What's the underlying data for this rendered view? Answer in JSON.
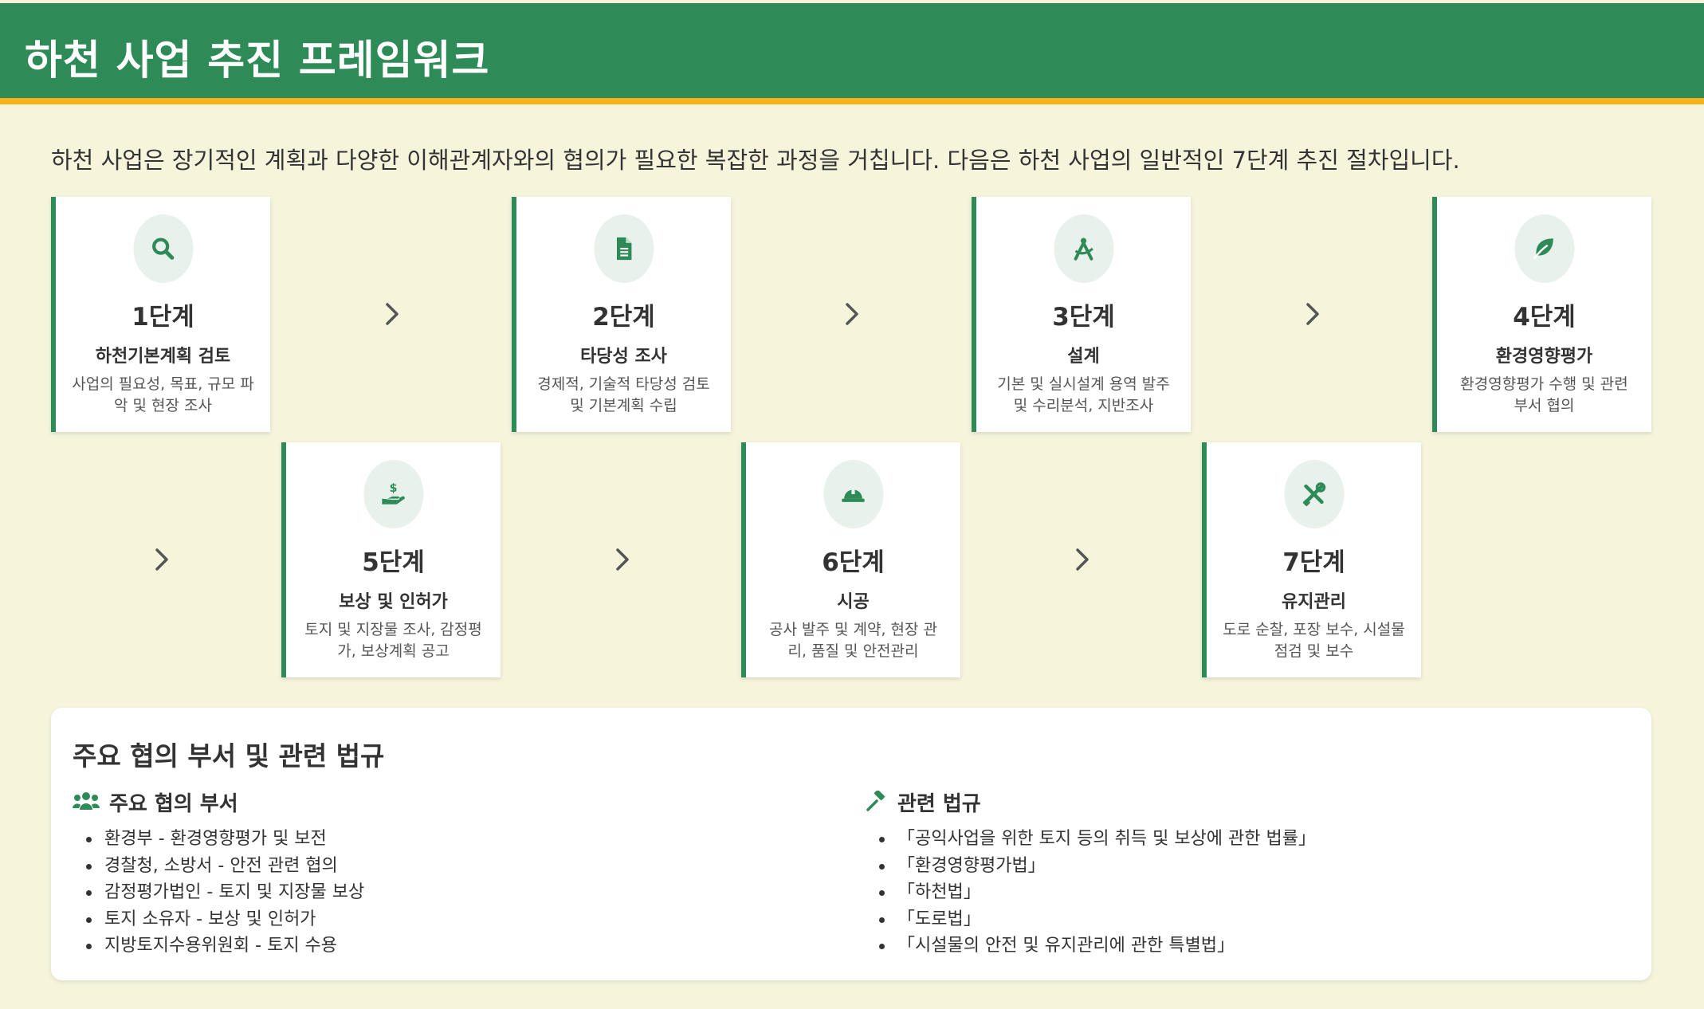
{
  "header": {
    "title": "하천 사업 추진 프레임워크"
  },
  "intro": "하천 사업은 장기적인 계획과 다양한 이해관계자와의 협의가 필요한 복잡한 과정을 거칩니다. 다음은 하천 사업의 일반적인 7단계 추진 절차입니다.",
  "steps": [
    {
      "step": "1단계",
      "title": "하천기본계획 검토",
      "desc": "사업의 필요성, 목표, 규모 파악 및 현장 조사",
      "icon": "search-icon"
    },
    {
      "step": "2단계",
      "title": "타당성 조사",
      "desc": "경제적, 기술적 타당성 검토 및 기본계획 수립",
      "icon": "document-icon"
    },
    {
      "step": "3단계",
      "title": "설계",
      "desc": "기본 및 실시설계 용역 발주 및 수리분석, 지반조사",
      "icon": "compass-icon"
    },
    {
      "step": "4단계",
      "title": "환경영향평가",
      "desc": "환경영향평가 수행 및 관련 부서 협의",
      "icon": "leaf-icon"
    },
    {
      "step": "5단계",
      "title": "보상 및 인허가",
      "desc": "토지 및 지장물 조사, 감정평가, 보상계획 공고",
      "icon": "hand-money-icon"
    },
    {
      "step": "6단계",
      "title": "시공",
      "desc": "공사 발주 및 계약, 현장 관리, 품질 및 안전관리",
      "icon": "hard-hat-icon"
    },
    {
      "step": "7단계",
      "title": "유지관리",
      "desc": "도로 순찰, 포장 보수, 시설물 점검 및 보수",
      "icon": "tools-icon"
    }
  ],
  "panel": {
    "title": "주요 협의 부서 및 관련 법규",
    "departments": {
      "heading": "주요 협의 부서",
      "items": [
        "환경부 - 환경영향평가 및 보전",
        "경찰청, 소방서 - 안전 관련 협의",
        "감정평가법인 - 토지 및 지장물 보상",
        "토지 소유자 - 보상 및 인허가",
        "지방토지수용위원회 - 토지 수용"
      ]
    },
    "laws": {
      "heading": "관련 법규",
      "items": [
        "「공익사업을 위한 토지 등의 취득 및 보상에 관한 법률」",
        "「환경영향평가법」",
        "「하천법」",
        "「도로법」",
        "「시설물의 안전 및 유지관리에 관한 특별법」"
      ]
    }
  },
  "colors": {
    "primary": "#2e8b57",
    "accent": "#f6b21a",
    "background": "#f6f5dc"
  }
}
